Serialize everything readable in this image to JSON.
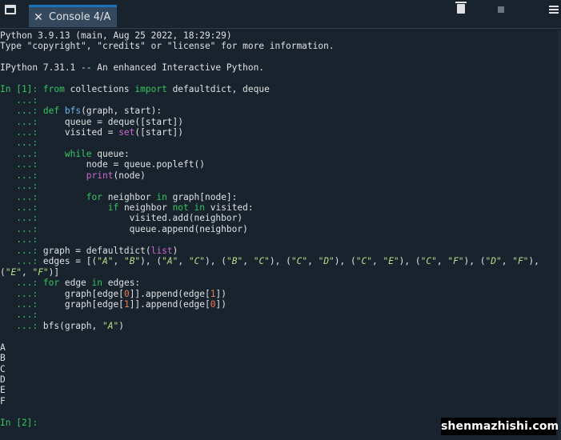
{
  "tab": {
    "title": "Console 4/A"
  },
  "toolbar": {
    "icons": [
      "window-icon",
      "close-icon",
      "trash-icon",
      "stop-icon",
      "menu-icon"
    ],
    "colors": {
      "accent": "#1a72bb",
      "background": "#19232d",
      "tab_bg": "#34495e"
    }
  },
  "console": {
    "banner": {
      "line1": "Python 3.9.13 (main, Aug 25 2022, 18:29:29)",
      "line2": "Type \"copyright\", \"credits\" or \"license\" for more information.",
      "line3": "IPython 7.31.1 -- An enhanced Interactive Python."
    },
    "prompts": {
      "in1": "In [1]: ",
      "cont": "   ...: ",
      "in2": "In [2]: "
    },
    "code": [
      [
        [
          "k",
          "from"
        ],
        [
          "t",
          " collections "
        ],
        [
          "k",
          "import"
        ],
        [
          "t",
          " defaultdict, deque"
        ]
      ],
      [],
      [
        [
          "k",
          "def"
        ],
        [
          "t",
          " "
        ],
        [
          "f",
          "bfs"
        ],
        [
          "t",
          "(graph, start):"
        ]
      ],
      [
        [
          "t",
          "    queue = deque([start])"
        ]
      ],
      [
        [
          "t",
          "    visited = "
        ],
        [
          "b",
          "set"
        ],
        [
          "t",
          "([start])"
        ]
      ],
      [],
      [
        [
          "t",
          "    "
        ],
        [
          "k",
          "while"
        ],
        [
          "t",
          " queue:"
        ]
      ],
      [
        [
          "t",
          "        node = queue.popleft()"
        ]
      ],
      [
        [
          "t",
          "        "
        ],
        [
          "b",
          "print"
        ],
        [
          "t",
          "(node)"
        ]
      ],
      [],
      [
        [
          "t",
          "        "
        ],
        [
          "k",
          "for"
        ],
        [
          "t",
          " neighbor "
        ],
        [
          "k",
          "in"
        ],
        [
          "t",
          " graph[node]:"
        ]
      ],
      [
        [
          "t",
          "            "
        ],
        [
          "k",
          "if"
        ],
        [
          "t",
          " neighbor "
        ],
        [
          "k",
          "not"
        ],
        [
          "t",
          " "
        ],
        [
          "k",
          "in"
        ],
        [
          "t",
          " visited:"
        ]
      ],
      [
        [
          "t",
          "                visited.add(neighbor)"
        ]
      ],
      [
        [
          "t",
          "                queue.append(neighbor)"
        ]
      ],
      [],
      [
        [
          "t",
          "graph = defaultdict("
        ],
        [
          "b",
          "list"
        ],
        [
          "t",
          ")"
        ]
      ],
      [
        [
          "t",
          "edges = [("
        ],
        [
          "s",
          "\"A\""
        ],
        [
          "t",
          ", "
        ],
        [
          "s",
          "\"B\""
        ],
        [
          "t",
          "), ("
        ],
        [
          "s",
          "\"A\""
        ],
        [
          "t",
          ", "
        ],
        [
          "s",
          "\"C\""
        ],
        [
          "t",
          "), ("
        ],
        [
          "s",
          "\"B\""
        ],
        [
          "t",
          ", "
        ],
        [
          "s",
          "\"C\""
        ],
        [
          "t",
          "), ("
        ],
        [
          "s",
          "\"C\""
        ],
        [
          "t",
          ", "
        ],
        [
          "s",
          "\"D\""
        ],
        [
          "t",
          "), ("
        ],
        [
          "s",
          "\"C\""
        ],
        [
          "t",
          ", "
        ],
        [
          "s",
          "\"E\""
        ],
        [
          "t",
          "), ("
        ],
        [
          "s",
          "\"C\""
        ],
        [
          "t",
          ", "
        ],
        [
          "s",
          "\"F\""
        ],
        [
          "t",
          "), ("
        ],
        [
          "s",
          "\"D\""
        ],
        [
          "t",
          ", "
        ],
        [
          "s",
          "\"F\""
        ],
        [
          "t",
          "),"
        ]
      ],
      [
        [
          "t",
          "("
        ],
        [
          "s",
          "\"E\""
        ],
        [
          "t",
          ", "
        ],
        [
          "s",
          "\"F\""
        ],
        [
          "t",
          ")]"
        ]
      ],
      [
        [
          "k",
          "for"
        ],
        [
          "t",
          " edge "
        ],
        [
          "k",
          "in"
        ],
        [
          "t",
          " edges:"
        ]
      ],
      [
        [
          "t",
          "    graph[edge["
        ],
        [
          "n",
          "0"
        ],
        [
          "t",
          "]].append(edge["
        ],
        [
          "n",
          "1"
        ],
        [
          "t",
          "])"
        ]
      ],
      [
        [
          "t",
          "    graph[edge["
        ],
        [
          "n",
          "1"
        ],
        [
          "t",
          "]].append(edge["
        ],
        [
          "n",
          "0"
        ],
        [
          "t",
          "])"
        ]
      ],
      [],
      [
        [
          "t",
          "bfs(graph, "
        ],
        [
          "s",
          "\"A\""
        ],
        [
          "t",
          ")"
        ]
      ]
    ],
    "output": [
      "A",
      "B",
      "C",
      "D",
      "E",
      "F"
    ]
  },
  "watermark": "shenmazhishi.com"
}
